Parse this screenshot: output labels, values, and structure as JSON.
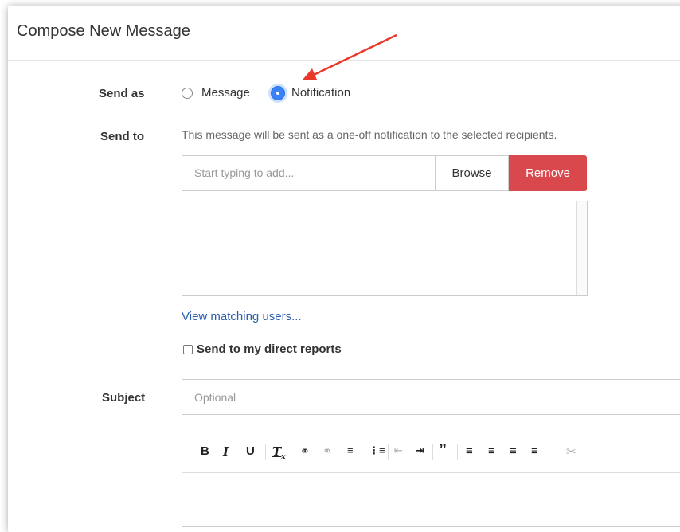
{
  "dialog": {
    "title": "Compose New Message"
  },
  "send_as": {
    "label": "Send as",
    "options": [
      "Message",
      "Notification"
    ],
    "selected": "Notification"
  },
  "send_to": {
    "label": "Send to",
    "help": "This message will be sent as a one-off notification to the selected recipients.",
    "input_placeholder": "Start typing to add...",
    "browse_label": "Browse",
    "remove_label": "Remove",
    "view_matching_label": "View matching users...",
    "direct_reports_label": "Send to my direct reports",
    "direct_reports_checked": false
  },
  "subject": {
    "label": "Subject",
    "placeholder": "Optional"
  },
  "toolbar_icons": [
    "bold-icon",
    "italic-icon",
    "underline-icon",
    "clear-format-icon",
    "link-icon",
    "unlink-icon",
    "ordered-list-icon",
    "unordered-list-icon",
    "outdent-icon",
    "indent-icon",
    "blockquote-icon",
    "align-left-icon",
    "align-center-icon",
    "align-right-icon",
    "justify-icon",
    "cut-icon"
  ],
  "colors": {
    "accent": "#3a82f7",
    "danger": "#d9484c",
    "link": "#2a5db0",
    "annotation_arrow": "#e8392a"
  }
}
